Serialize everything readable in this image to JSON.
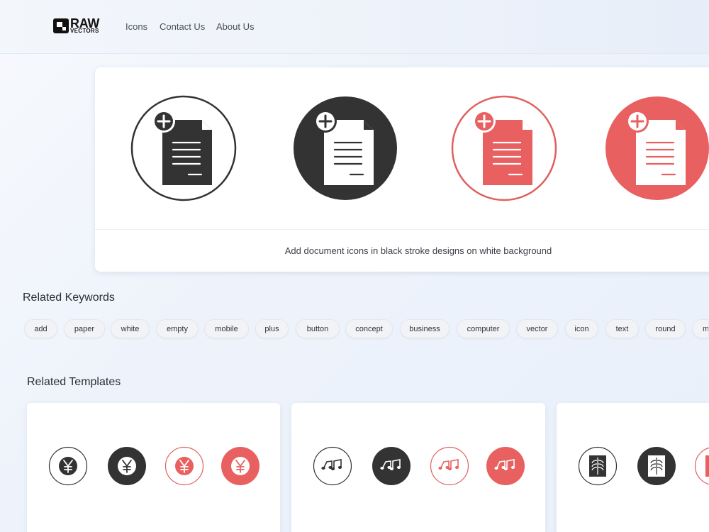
{
  "header": {
    "logo_main": "RAW",
    "logo_sub": "VECTORS",
    "nav": [
      "Icons",
      "Contact Us",
      "About Us"
    ]
  },
  "hero": {
    "caption": "Add document icons in black stroke designs on white background",
    "variants": [
      {
        "style": "outline",
        "color": "#333333"
      },
      {
        "style": "filled",
        "color": "#333333"
      },
      {
        "style": "outline",
        "color": "#e06060"
      },
      {
        "style": "filled",
        "color": "#e86060"
      }
    ]
  },
  "related_keywords": {
    "title": "Related Keywords",
    "items": [
      "add",
      "paper",
      "white",
      "empty",
      "mobile",
      "plus",
      "button",
      "concept",
      "business",
      "computer",
      "vector",
      "icon",
      "text",
      "round",
      "m"
    ]
  },
  "related_templates": {
    "title": "Related Templates",
    "cards": [
      {
        "icon": "yen-icon"
      },
      {
        "icon": "music-notes-icon"
      },
      {
        "icon": "xray-icon"
      }
    ]
  },
  "colors": {
    "accent": "#e86060",
    "dark": "#333333"
  }
}
